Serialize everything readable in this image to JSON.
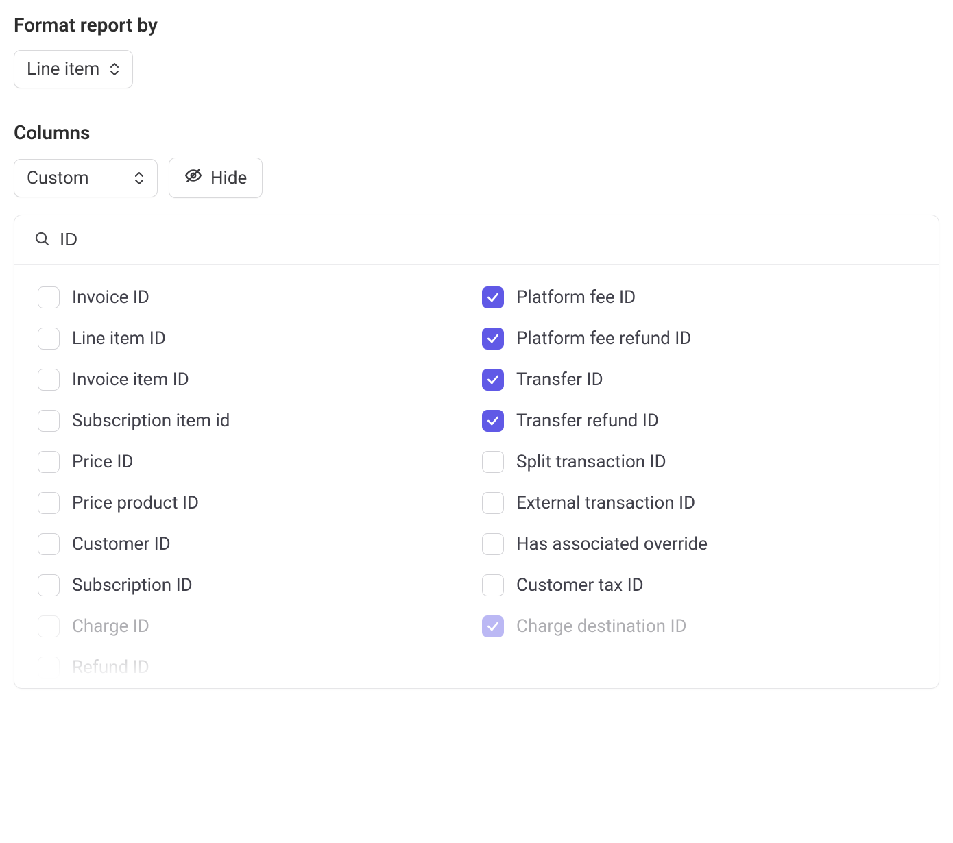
{
  "format_report": {
    "label": "Format report by",
    "selected": "Line item"
  },
  "columns": {
    "label": "Columns",
    "selected": "Custom",
    "hide_button": "Hide"
  },
  "search": {
    "value": "ID"
  },
  "options": {
    "left": [
      {
        "label": "Invoice ID",
        "checked": false,
        "faded": false
      },
      {
        "label": "Line item ID",
        "checked": false,
        "faded": false
      },
      {
        "label": "Invoice item ID",
        "checked": false,
        "faded": false
      },
      {
        "label": "Subscription item id",
        "checked": false,
        "faded": false
      },
      {
        "label": "Price ID",
        "checked": false,
        "faded": false
      },
      {
        "label": "Price product ID",
        "checked": false,
        "faded": false
      },
      {
        "label": "Customer ID",
        "checked": false,
        "faded": false
      },
      {
        "label": "Subscription ID",
        "checked": false,
        "faded": false
      },
      {
        "label": "Charge ID",
        "checked": false,
        "faded": true
      },
      {
        "label": "Refund ID",
        "checked": false,
        "faded": true
      }
    ],
    "right": [
      {
        "label": "Platform fee ID",
        "checked": true,
        "faded": false
      },
      {
        "label": "Platform fee refund ID",
        "checked": true,
        "faded": false
      },
      {
        "label": "Transfer ID",
        "checked": true,
        "faded": false
      },
      {
        "label": "Transfer refund ID",
        "checked": true,
        "faded": false
      },
      {
        "label": "Split transaction ID",
        "checked": false,
        "faded": false
      },
      {
        "label": "External transaction ID",
        "checked": false,
        "faded": false
      },
      {
        "label": "Has associated override",
        "checked": false,
        "faded": false
      },
      {
        "label": "Customer tax ID",
        "checked": false,
        "faded": false
      },
      {
        "label": "Charge destination ID",
        "checked": true,
        "faded": true
      }
    ]
  }
}
